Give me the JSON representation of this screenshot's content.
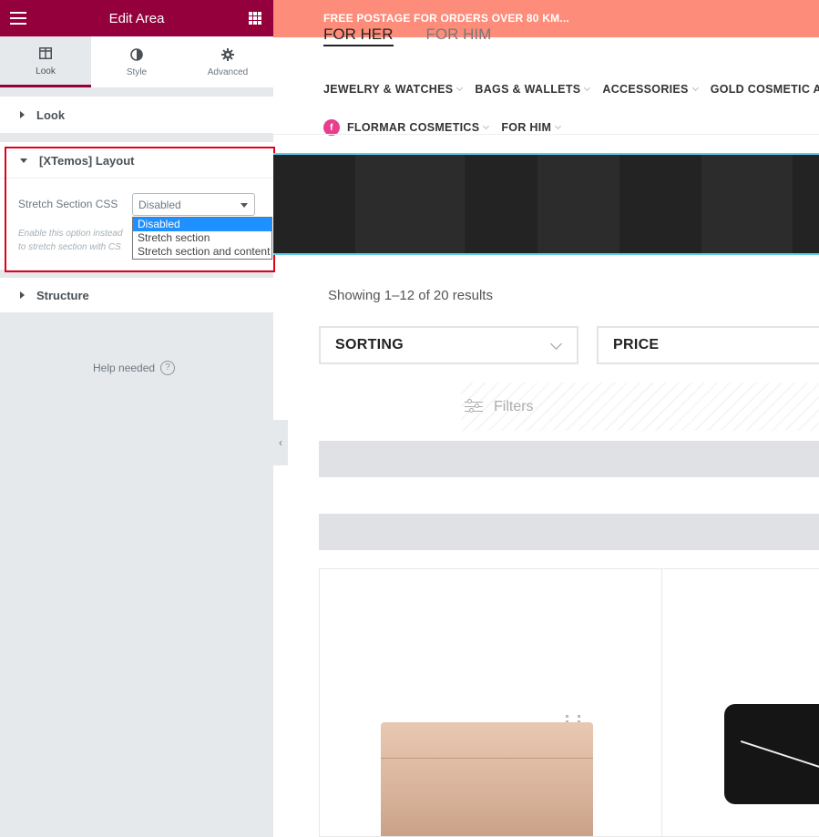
{
  "editor": {
    "title": "Edit Area",
    "tabs": [
      {
        "label": "Look",
        "icon": "columns-icon",
        "active": true
      },
      {
        "label": "Style",
        "icon": "contrast-icon",
        "active": false
      },
      {
        "label": "Advanced",
        "icon": "gear-icon",
        "active": false
      }
    ],
    "sections": {
      "look": "Look",
      "layout": "[XTemos] Layout",
      "structure": "Structure"
    },
    "stretch_control": {
      "label": "Stretch Section CSS",
      "value": "Disabled",
      "description_line1": "Enable this option instead",
      "description_line2": "to stretch section with CS",
      "options": [
        "Disabled",
        "Stretch section",
        "Stretch section and content"
      ],
      "selected_index": 0
    },
    "help": "Help needed",
    "colors": {
      "brand": "#93003c",
      "highlight": "#e0001a",
      "option_selected": "#1e90ff"
    }
  },
  "store": {
    "promo": "FREE POSTAGE FOR ORDERS OVER 80 KM...",
    "gender_tabs": [
      "FOR HER",
      "FOR HIM"
    ],
    "menu_row1": [
      "JEWELRY & WATCHES",
      "BAGS & WALLETS",
      "ACCESSORIES",
      "GOLD COSMETIC AC"
    ],
    "menu_row2": [
      "FLORMAR COSMETICS",
      "FOR HIM"
    ],
    "flormar_badge": "f",
    "results": "Showing 1–12 of 20 results",
    "sorting": "SORTING",
    "price": "PRICE",
    "filters": "Filters",
    "colors": {
      "promo": "#fd8c7a",
      "hero": "#232323",
      "hero_border": "#5ad0ea"
    }
  }
}
